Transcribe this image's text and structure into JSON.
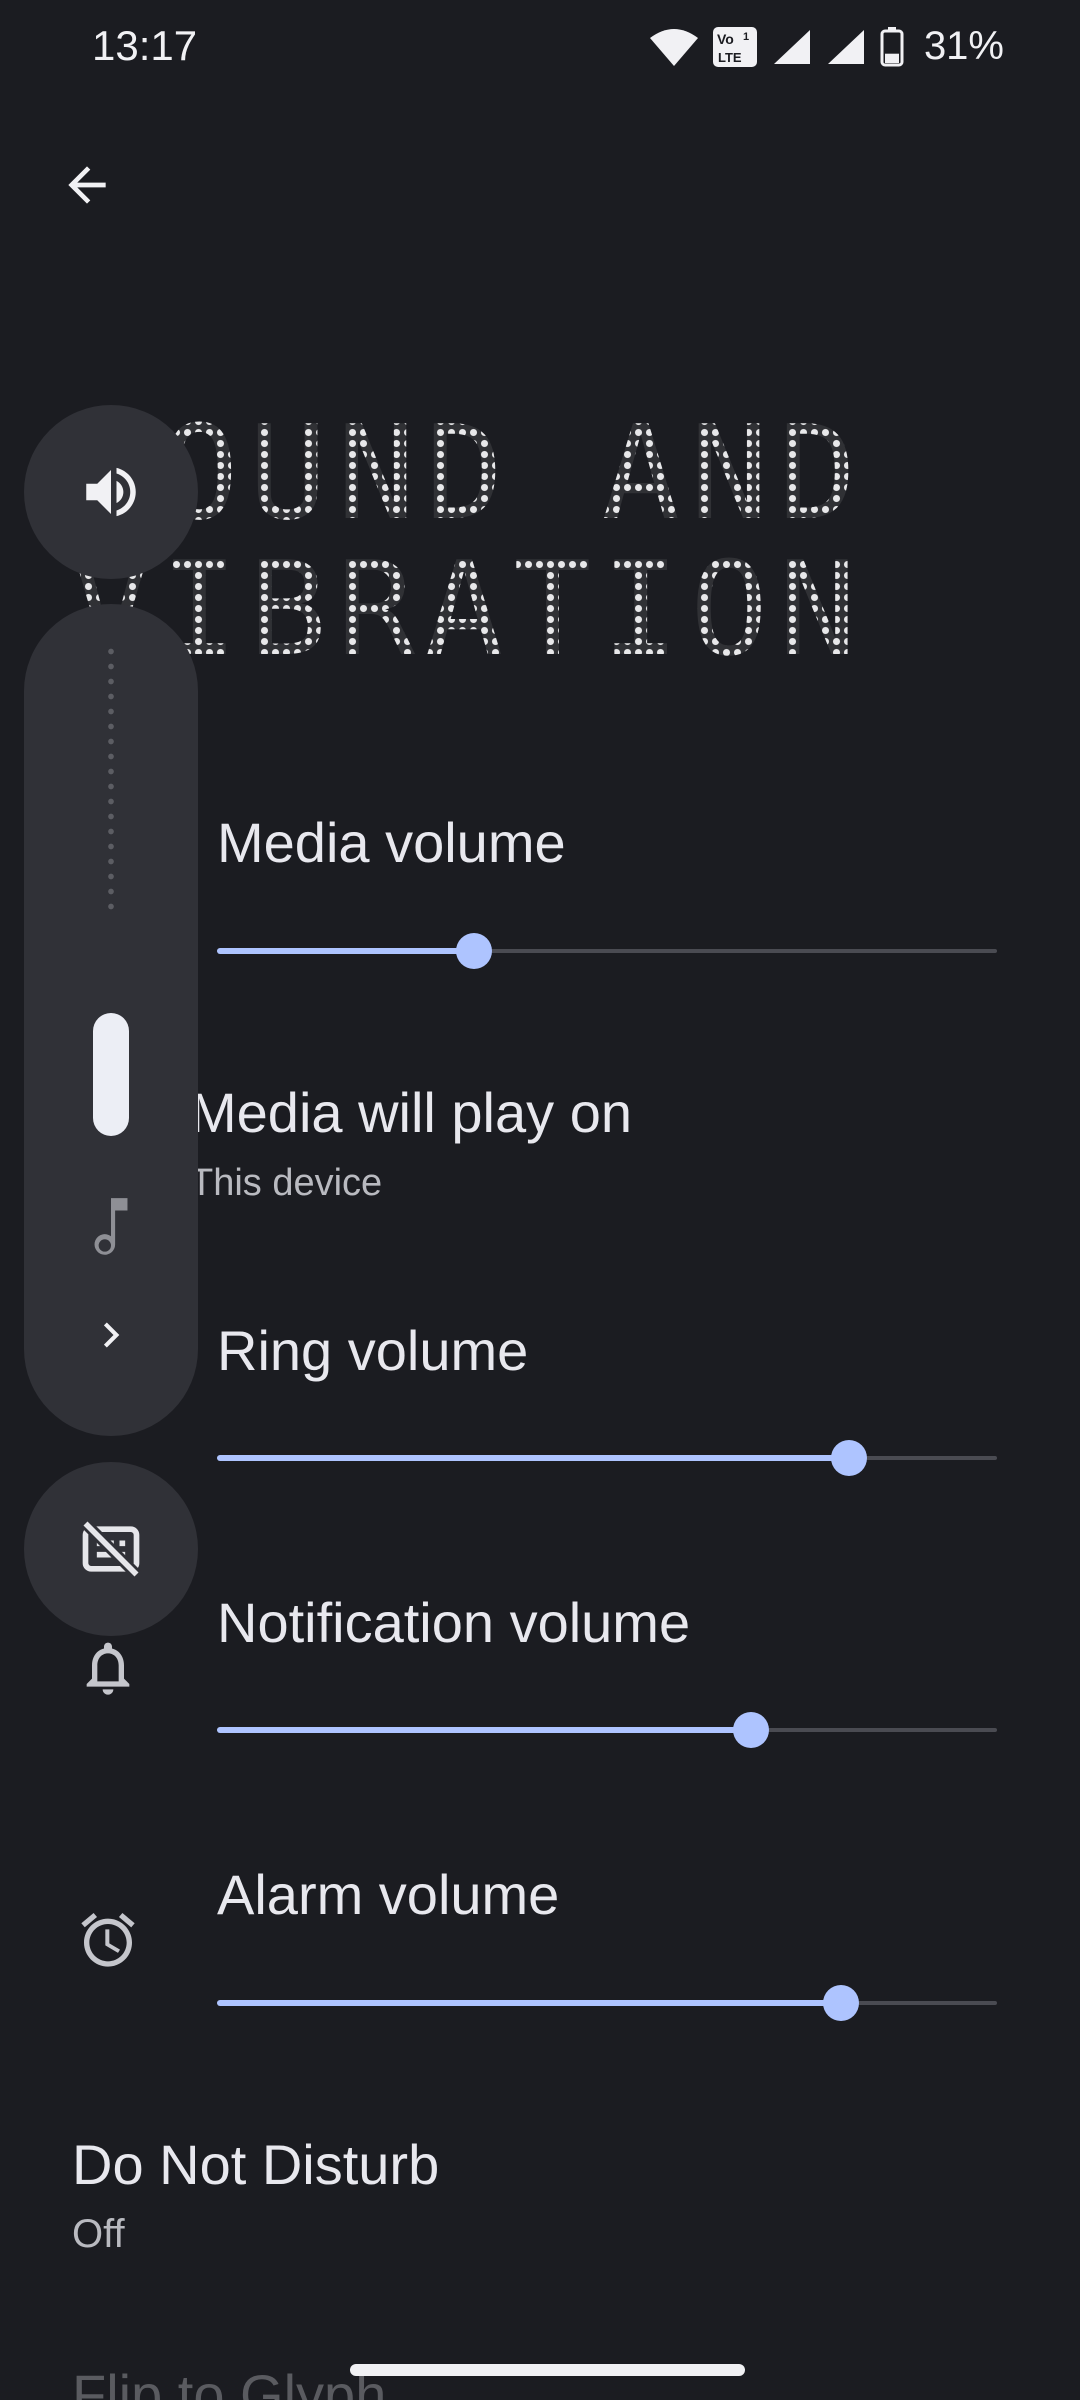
{
  "status_bar": {
    "time": "13:17",
    "volte_top": "Vo",
    "volte_bottom": "LTE",
    "volte_sim": "1",
    "battery_percent": "31%",
    "battery_level": 0.31
  },
  "header": {
    "title_line1": "SOUND AND",
    "title_line2": "VIBRATION"
  },
  "settings": {
    "media_volume": {
      "label": "Media volume",
      "value": 0.33
    },
    "play_on": {
      "title": "Media will play on",
      "subtitle": "This device"
    },
    "ring_volume": {
      "label": "Ring volume",
      "value": 0.81
    },
    "notification_volume": {
      "label": "Notification volume",
      "value": 0.685
    },
    "alarm_volume": {
      "label": "Alarm volume",
      "value": 0.8
    },
    "do_not_disturb": {
      "title": "Do Not Disturb",
      "subtitle": "Off"
    },
    "flip_to_glyph": {
      "title": "Flip to Glyph"
    }
  },
  "volume_panel": {
    "level": 0.28,
    "stream": "music-note-icon"
  },
  "colors": {
    "background": "#1b1c21",
    "accent": "#aec4ff",
    "panel": "#303137"
  }
}
